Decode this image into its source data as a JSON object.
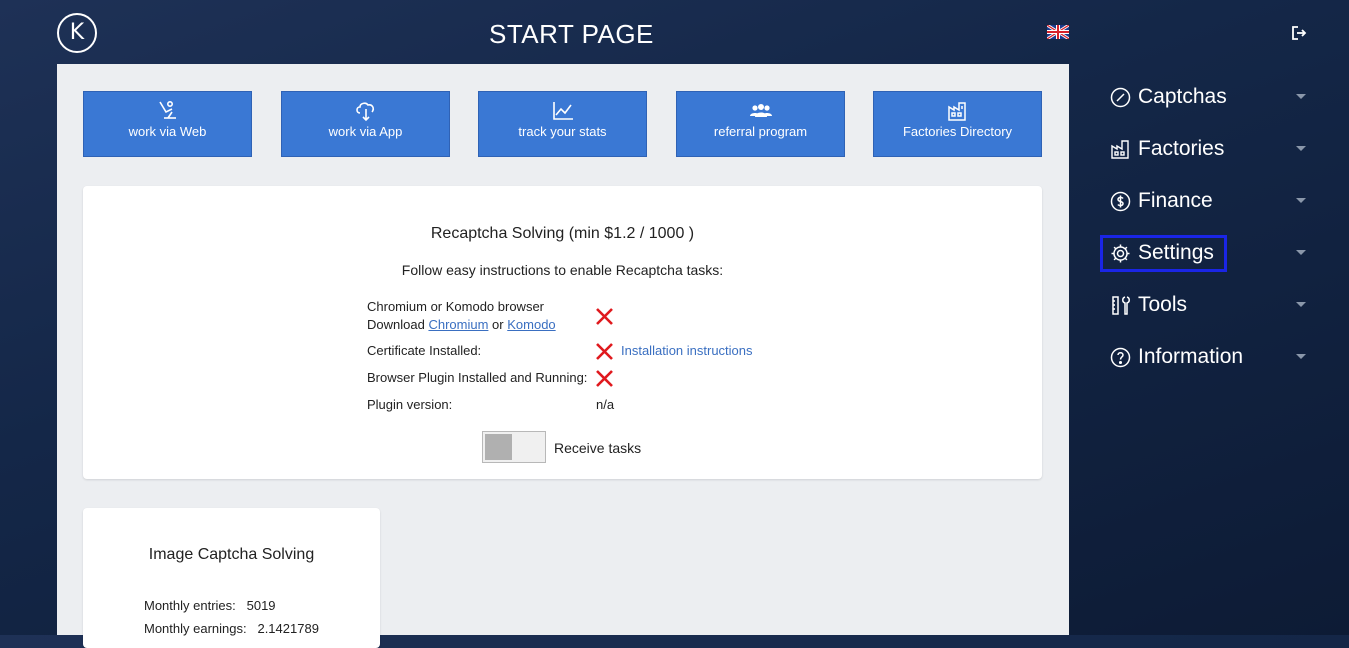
{
  "header": {
    "logo_letter": "K",
    "title": "START PAGE",
    "language_icon": "uk-flag-icon",
    "logout_icon": "logout-icon"
  },
  "quick_actions": [
    {
      "label": "work via Web",
      "icon": "worker-icon"
    },
    {
      "label": "work via App",
      "icon": "cloud-download-icon"
    },
    {
      "label": "track your stats",
      "icon": "chart-icon"
    },
    {
      "label": "referral program",
      "icon": "people-icon"
    },
    {
      "label": "Factories Directory",
      "icon": "factory-icon"
    }
  ],
  "recaptcha": {
    "title": "Recaptcha Solving (min $1.2 / 1000 )",
    "subtitle": "Follow easy instructions to enable Recaptcha tasks:",
    "browser_label": "Chromium or Komodo browser",
    "download_prefix": "Download",
    "chromium_link": "Chromium",
    "or_text": "or",
    "komodo_link": "Komodo",
    "certificate_label": "Certificate Installed:",
    "installation_link": "Installation instructions",
    "plugin_label": "Browser Plugin Installed and Running:",
    "plugin_version_label": "Plugin version:",
    "plugin_version_value": "n/a",
    "receive_tasks_label": "Receive tasks",
    "receive_tasks_on": false,
    "status_color": "#e0191e"
  },
  "image_captcha": {
    "title": "Image Captcha Solving",
    "monthly_entries_label": "Monthly entries:",
    "monthly_entries_value": "5019",
    "monthly_earnings_label": "Monthly earnings:",
    "monthly_earnings_value": "2.1421789"
  },
  "sidebar": {
    "items": [
      {
        "label": "Captchas",
        "icon": "captcha-icon"
      },
      {
        "label": "Factories",
        "icon": "factory-icon"
      },
      {
        "label": "Finance",
        "icon": "dollar-icon"
      },
      {
        "label": "Settings",
        "icon": "gear-icon",
        "focused": true
      },
      {
        "label": "Tools",
        "icon": "tools-icon"
      },
      {
        "label": "Information",
        "icon": "question-icon"
      }
    ]
  },
  "colors": {
    "accent": "#3a78d4",
    "link": "#3a6fc1",
    "error": "#e0191e",
    "focus": "#1a25e6",
    "background": "#142748"
  }
}
